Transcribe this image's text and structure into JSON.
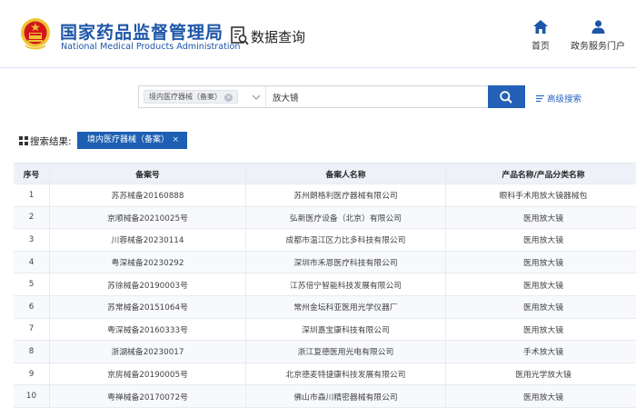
{
  "header": {
    "brand_cn": "国家药品监督管理局",
    "brand_en": "National Medical Products Administration",
    "page_title": "数据查询",
    "nav": [
      {
        "label": "首页",
        "icon": "home-icon"
      },
      {
        "label": "政务服务门户",
        "icon": "user-icon"
      }
    ]
  },
  "search": {
    "category_tag": "境内医疗器械（备案）",
    "query": "放大镜",
    "advanced_label": "高级搜索"
  },
  "results": {
    "label": "搜索结果:",
    "active_filter": "境内医疗器械（备案）"
  },
  "table": {
    "columns": [
      "序号",
      "备案号",
      "备案人名称",
      "产品名称/产品分类名称"
    ],
    "rows": [
      [
        "1",
        "苏苏械备20160888",
        "苏州朗格利医疗器械有限公司",
        "眼科手术用放大镜器械包"
      ],
      [
        "2",
        "京顺械备20210025号",
        "弘新医疗设备（北京）有限公司",
        "医用放大镜"
      ],
      [
        "3",
        "川蓉械备20230114",
        "成都市温江区力比多科技有限公司",
        "医用放大镜"
      ],
      [
        "4",
        "粤深械备20230292",
        "深圳市禾恩医疗科技有限公司",
        "医用放大镜"
      ],
      [
        "5",
        "苏徐械备20190003号",
        "江苏倍宁智能科技发展有限公司",
        "医用放大镜"
      ],
      [
        "6",
        "苏常械备20151064号",
        "常州金坛科亚医用光学仪器厂",
        "医用放大镜"
      ],
      [
        "7",
        "粤深械备20160333号",
        "深圳嘉宝康科技有限公司",
        "医用放大镜"
      ],
      [
        "8",
        "浙湖械备20230017",
        "浙江复德医用光电有限公司",
        "手术放大镜"
      ],
      [
        "9",
        "京房械备20190005号",
        "北京德麦特捷康科技发展有限公司",
        "医用光学放大镜"
      ],
      [
        "10",
        "粤禅械备20170072号",
        "佛山市森川精密器械有限公司",
        "医用放大镜"
      ]
    ]
  },
  "colors": {
    "brand_blue": "#1d56a8",
    "button_blue": "#2460b5",
    "emblem_red": "#d0161c",
    "emblem_gold": "#f1c232"
  }
}
